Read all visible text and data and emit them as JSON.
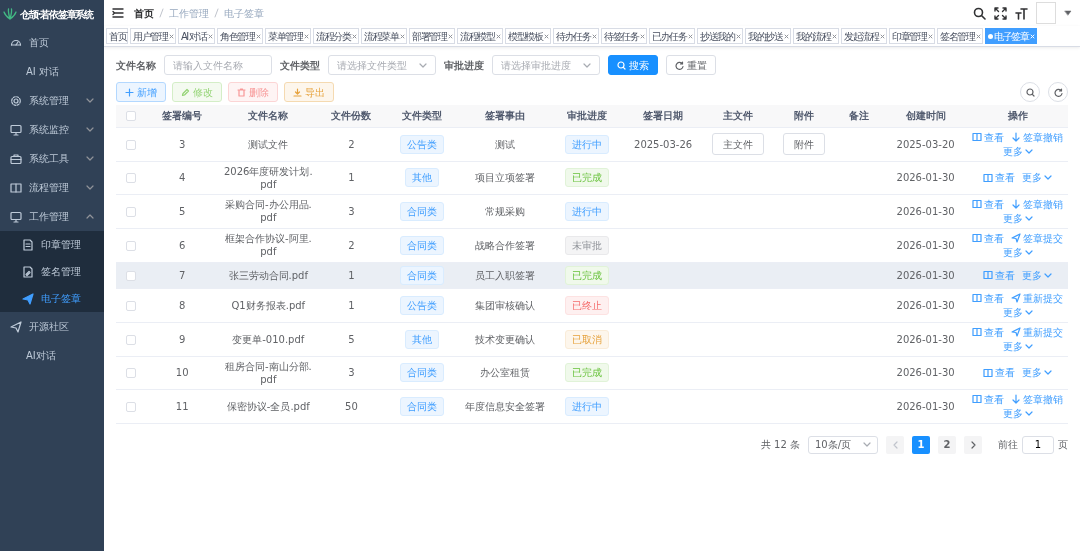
{
  "sidebar": {
    "logo_text": "仓颉·若依签章系统",
    "items": [
      {
        "label": "首页",
        "selected": false
      },
      {
        "label": "AI 对话",
        "selected": false
      },
      {
        "label": "系统管理",
        "selected": false,
        "expanded": false
      },
      {
        "label": "系统监控",
        "selected": false,
        "expanded": false
      },
      {
        "label": "系统工具",
        "selected": false,
        "expanded": false
      },
      {
        "label": "流程管理",
        "selected": false,
        "expanded": false
      },
      {
        "label": "工作管理",
        "selected": false,
        "expanded": true,
        "children": [
          {
            "label": "印章管理",
            "selected": false
          },
          {
            "label": "签名管理",
            "selected": false
          },
          {
            "label": "电子签章",
            "selected": true
          }
        ]
      },
      {
        "label": "开源社区",
        "selected": false
      },
      {
        "label": "AI对话",
        "selected": false
      }
    ]
  },
  "breadcrumbs": [
    "首页",
    "工作管理",
    "电子签章"
  ],
  "tabs": [
    {
      "label": "首页",
      "selected": false,
      "closable": false
    },
    {
      "label": "用户管理",
      "selected": false,
      "closable": true
    },
    {
      "label": "AI 对话",
      "selected": false,
      "closable": true
    },
    {
      "label": "角色管理",
      "selected": false,
      "closable": true
    },
    {
      "label": "菜单管理",
      "selected": false,
      "closable": true
    },
    {
      "label": "流程分类",
      "selected": false,
      "closable": true
    },
    {
      "label": "流程菜单",
      "selected": false,
      "closable": true
    },
    {
      "label": "部署管理",
      "selected": false,
      "closable": true
    },
    {
      "label": "流程模型",
      "selected": false,
      "closable": true
    },
    {
      "label": "模型模板",
      "selected": false,
      "closable": true
    },
    {
      "label": "待办任务",
      "selected": false,
      "closable": true
    },
    {
      "label": "待签任务",
      "selected": false,
      "closable": true
    },
    {
      "label": "已办任务",
      "selected": false,
      "closable": true
    },
    {
      "label": "抄送我的",
      "selected": false,
      "closable": true
    },
    {
      "label": "我的抄送",
      "selected": false,
      "closable": true
    },
    {
      "label": "我的流程",
      "selected": false,
      "closable": true
    },
    {
      "label": "发起流程",
      "selected": false,
      "closable": true
    },
    {
      "label": "印章管理",
      "selected": false,
      "closable": true
    },
    {
      "label": "签名管理",
      "selected": false,
      "closable": true
    },
    {
      "label": "电子签章",
      "selected": true,
      "closable": true
    }
  ],
  "filters": [
    {
      "label": "文件名称",
      "placeholder": "请输入文件名称",
      "kind": "input"
    },
    {
      "label": "文件类型",
      "placeholder": "请选择文件类型",
      "kind": "select"
    },
    {
      "label": "审批进度",
      "placeholder": "请选择审批进度",
      "kind": "select"
    }
  ],
  "search_button": "搜索",
  "reset_button": "重置",
  "toolbar": [
    {
      "label": "新增",
      "kind": "primary"
    },
    {
      "label": "修改",
      "kind": "success"
    },
    {
      "label": "删除",
      "kind": "danger"
    },
    {
      "label": "导出",
      "kind": "warning"
    }
  ],
  "table": {
    "select_all_checked": false,
    "columns": [
      "签署编号",
      "文件名称",
      "文件份数",
      "文件类型",
      "签署事由",
      "审批进度",
      "签署日期",
      "主文件",
      "附件",
      "备注",
      "创建时间",
      "操作"
    ],
    "rows": [
      {
        "checked": false,
        "hovered": false,
        "no": "3",
        "file_name": "测试文件",
        "copies": "2",
        "type": "公告类",
        "reason": "测试",
        "status": {
          "label": "进行中",
          "kind": "primary"
        },
        "date": "2025-03-26",
        "main_file": "主文件",
        "attachment": "附件",
        "created": "2025-03-20",
        "actions": [
          {
            "label": "查看",
            "kind": "view"
          },
          {
            "label": "签章撤销",
            "kind": "revoke"
          },
          {
            "label": "更多",
            "kind": "more"
          }
        ]
      },
      {
        "checked": false,
        "hovered": false,
        "no": "4",
        "file_name": "2026年度研发计划.pdf",
        "copies": "1",
        "type": "其他",
        "reason": "项目立项签署",
        "status": {
          "label": "已完成",
          "kind": "success"
        },
        "created": "2026-01-30",
        "actions": [
          {
            "label": "查看",
            "kind": "view"
          },
          {
            "label": "更多",
            "kind": "more"
          }
        ]
      },
      {
        "checked": false,
        "hovered": false,
        "no": "5",
        "file_name": "采购合同-办公用品.pdf",
        "copies": "3",
        "type": "合同类",
        "reason": "常规采购",
        "status": {
          "label": "进行中",
          "kind": "primary"
        },
        "created": "2026-01-30",
        "actions": [
          {
            "label": "查看",
            "kind": "view"
          },
          {
            "label": "签章撤销",
            "kind": "revoke"
          },
          {
            "label": "更多",
            "kind": "more"
          }
        ]
      },
      {
        "checked": false,
        "hovered": false,
        "no": "6",
        "file_name": "框架合作协议-阿里.pdf",
        "copies": "2",
        "type": "合同类",
        "reason": "战略合作签署",
        "status": {
          "label": "未审批",
          "kind": "info"
        },
        "created": "2026-01-30",
        "actions": [
          {
            "label": "查看",
            "kind": "view"
          },
          {
            "label": "签章提交",
            "kind": "submit"
          },
          {
            "label": "更多",
            "kind": "more"
          }
        ]
      },
      {
        "checked": false,
        "hovered": true,
        "no": "7",
        "file_name": "张三劳动合同.pdf",
        "copies": "1",
        "type": "合同类",
        "reason": "员工入职签署",
        "status": {
          "label": "已完成",
          "kind": "success"
        },
        "created": "2026-01-30",
        "actions": [
          {
            "label": "查看",
            "kind": "view"
          },
          {
            "label": "更多",
            "kind": "more"
          }
        ]
      },
      {
        "checked": false,
        "hovered": false,
        "no": "8",
        "file_name": "Q1财务报表.pdf",
        "copies": "1",
        "type": "公告类",
        "reason": "集团审核确认",
        "status": {
          "label": "已终止",
          "kind": "danger"
        },
        "created": "2026-01-30",
        "actions": [
          {
            "label": "查看",
            "kind": "view"
          },
          {
            "label": "重新提交",
            "kind": "submit"
          },
          {
            "label": "更多",
            "kind": "more"
          }
        ]
      },
      {
        "checked": false,
        "hovered": false,
        "no": "9",
        "file_name": "变更单-010.pdf",
        "copies": "5",
        "type": "其他",
        "reason": "技术变更确认",
        "status": {
          "label": "已取消",
          "kind": "warning"
        },
        "created": "2026-01-30",
        "actions": [
          {
            "label": "查看",
            "kind": "view"
          },
          {
            "label": "重新提交",
            "kind": "submit"
          },
          {
            "label": "更多",
            "kind": "more"
          }
        ]
      },
      {
        "checked": false,
        "hovered": false,
        "no": "10",
        "file_name": "租房合同-南山分部.pdf",
        "copies": "3",
        "type": "合同类",
        "reason": "办公室租赁",
        "status": {
          "label": "已完成",
          "kind": "success"
        },
        "created": "2026-01-30",
        "actions": [
          {
            "label": "查看",
            "kind": "view"
          },
          {
            "label": "更多",
            "kind": "more"
          }
        ]
      },
      {
        "checked": false,
        "hovered": false,
        "no": "11",
        "file_name": "保密协议-全员.pdf",
        "copies": "50",
        "type": "合同类",
        "reason": "年度信息安全签署",
        "status": {
          "label": "进行中",
          "kind": "primary"
        },
        "created": "2026-01-30",
        "actions": [
          {
            "label": "查看",
            "kind": "view"
          },
          {
            "label": "签章撤销",
            "kind": "revoke"
          },
          {
            "label": "更多",
            "kind": "more"
          }
        ]
      }
    ]
  },
  "pagination": {
    "total": "共 12 条",
    "page_size": "10条/页",
    "prev_disabled": true,
    "next_disabled": false,
    "pages": [
      {
        "label": "1",
        "selected": true
      },
      {
        "label": "2",
        "selected": false
      }
    ],
    "goto_label": "前往",
    "goto_value": "1",
    "goto_suffix": "页"
  }
}
